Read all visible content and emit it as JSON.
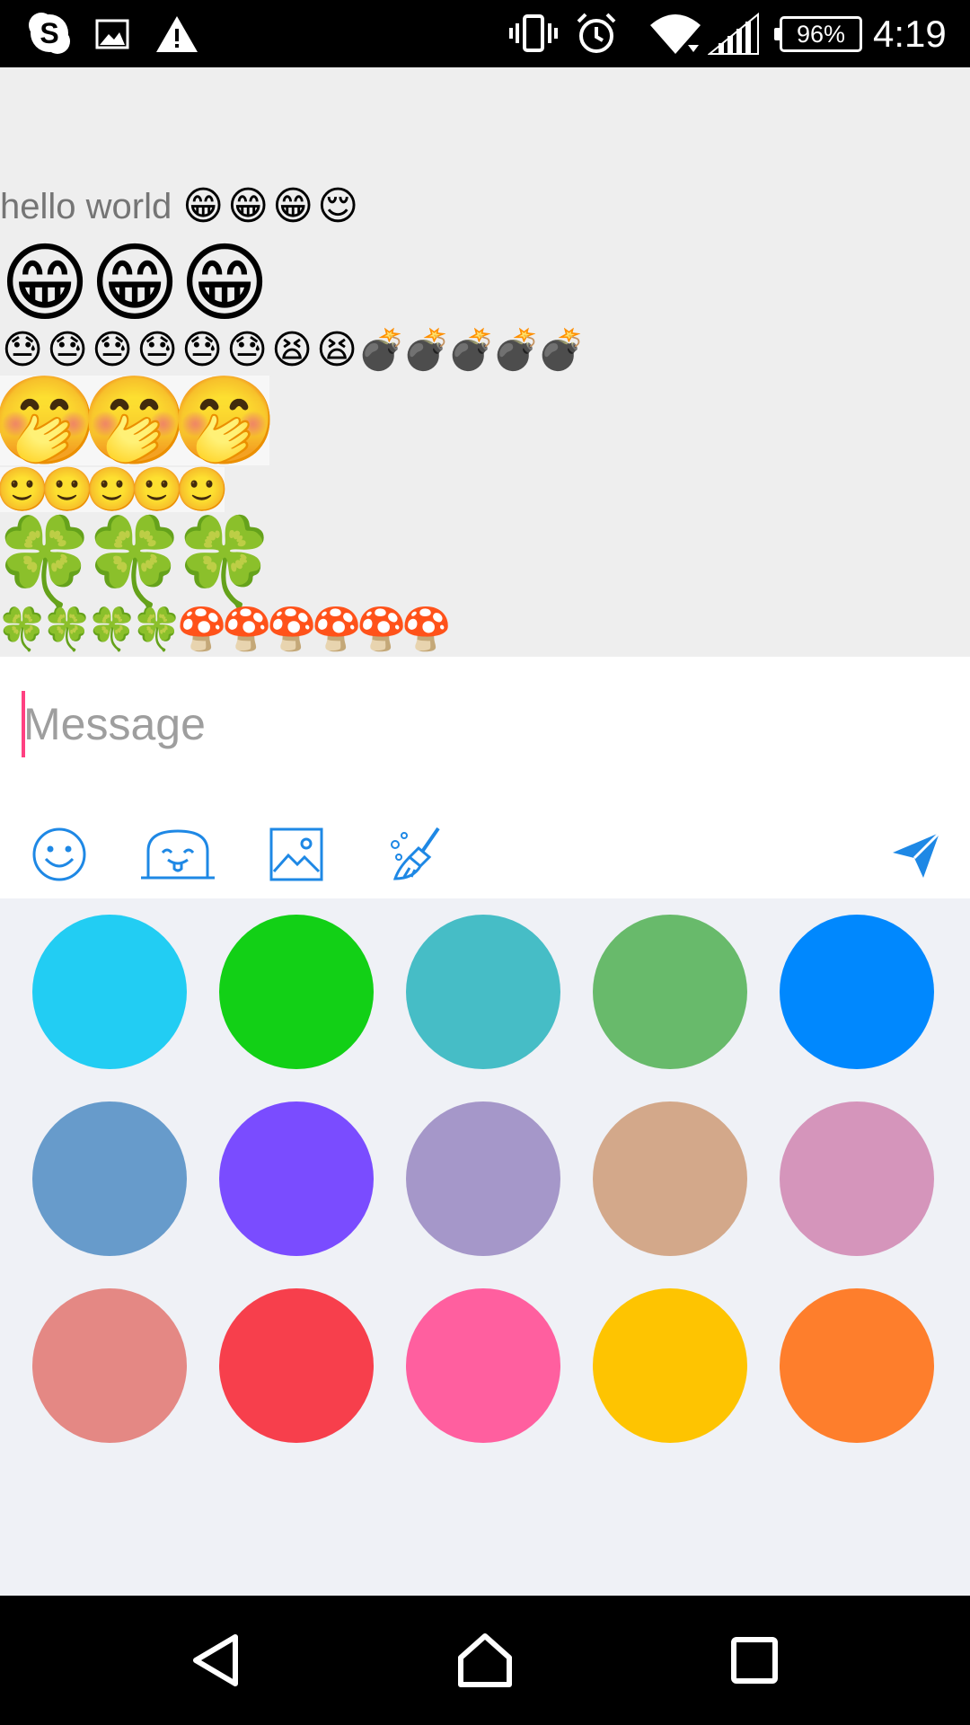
{
  "status_bar": {
    "icons_left": [
      "skype-icon",
      "image-notification-icon",
      "warning-icon"
    ],
    "icons_right": [
      "vibrate-icon",
      "alarm-icon",
      "wifi-icon",
      "cell-signal-icon"
    ],
    "battery": "96%",
    "time": "4:19"
  },
  "chat": {
    "message_text": "hello world",
    "rows": [
      {
        "emoji": [
          "😁",
          "😁",
          "😁",
          "😌"
        ]
      },
      {
        "emoji": [
          "😁",
          "😁",
          "😁"
        ]
      },
      {
        "emoji": [
          "😓",
          "😓",
          "😓",
          "😓",
          "😓",
          "😓",
          "😫",
          "😫",
          "💣",
          "💣",
          "💣",
          "💣",
          "💣"
        ]
      },
      {
        "emoji": [
          "🤭",
          "🤭",
          "🤭"
        ]
      },
      {
        "emoji": [
          "🙂",
          "🙂",
          "🙂",
          "🙂",
          "🙂"
        ]
      },
      {
        "emoji": [
          "🍀",
          "🍀",
          "🍀"
        ]
      },
      {
        "emoji": [
          "🍀",
          "🍀",
          "🍀",
          "🍀",
          "🍄",
          "🍄",
          "🍄",
          "🍄",
          "🍄",
          "🍄"
        ]
      }
    ]
  },
  "input": {
    "placeholder": "Message",
    "value": ""
  },
  "toolbar": {
    "tools": [
      "emoji-icon",
      "sticker-icon",
      "image-icon",
      "clear-format-icon",
      "send-icon"
    ],
    "accent": "#1e88e5"
  },
  "palette": {
    "colors": [
      "#22cdf3",
      "#12d016",
      "#46bdc6",
      "#68ba6b",
      "#0088fe",
      "#679bcb",
      "#7a4cff",
      "#a597c9",
      "#d3a88a",
      "#d595bb",
      "#e48884",
      "#f73f4c",
      "#ff5f9f",
      "#fec401",
      "#fe7e2c"
    ]
  },
  "nav_bar": {
    "buttons": [
      "back-icon",
      "home-icon",
      "recents-icon"
    ]
  }
}
